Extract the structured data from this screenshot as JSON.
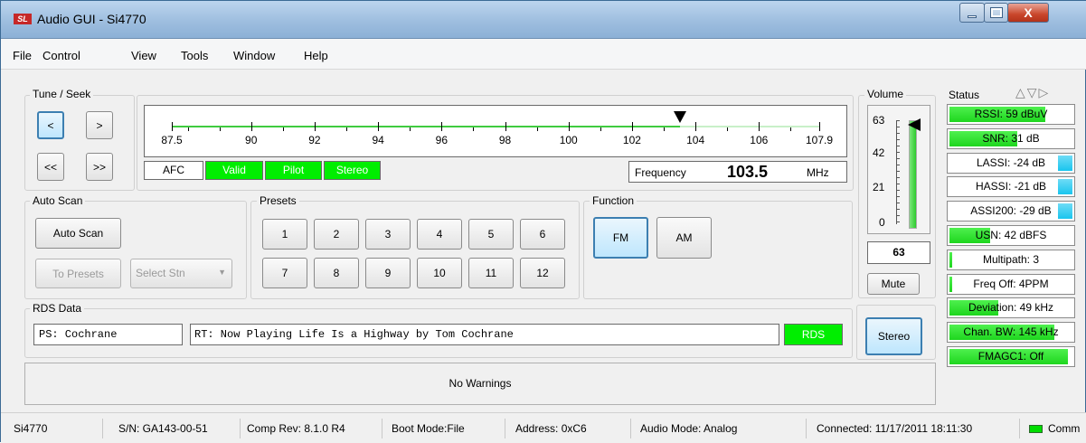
{
  "window": {
    "title": "Audio GUI - Si4770",
    "close_glyph": "X"
  },
  "menu": [
    "File",
    "Control",
    "View",
    "Tools",
    "Window",
    "Help"
  ],
  "tune_seek": {
    "label": "Tune / Seek",
    "buttons": [
      "<",
      ">",
      "<<",
      ">>"
    ],
    "scale_ticks": [
      "87.5",
      "90",
      "92",
      "94",
      "96",
      "98",
      "100",
      "102",
      "104",
      "106",
      "107.9"
    ],
    "current_frequency": 103.5,
    "indicators": [
      {
        "label": "AFC",
        "active": false
      },
      {
        "label": "Valid",
        "active": true
      },
      {
        "label": "Pilot",
        "active": true
      },
      {
        "label": "Stereo",
        "active": true
      }
    ],
    "frequency_label": "Frequency",
    "frequency_value": "103.5",
    "frequency_unit": "MHz"
  },
  "volume": {
    "label": "Volume",
    "ticks": [
      "63",
      "42",
      "21",
      "0"
    ],
    "value": "63",
    "level": 1.0,
    "mute_label": "Mute"
  },
  "status": {
    "label": "Status",
    "arrows": "△▽▷",
    "items": [
      {
        "text": "RSSI: 59 dBuV",
        "fill": 0.78
      },
      {
        "text": "SNR: 31 dB",
        "fill": 0.55
      },
      {
        "text": "LASSI: -24 dB",
        "fill": 0.12,
        "right": true
      },
      {
        "text": "HASSI: -21 dB",
        "fill": 0.12,
        "right": true
      },
      {
        "text": "ASSI200: -29 dB",
        "fill": 0.12,
        "right": true
      },
      {
        "text": "USN: 42 dBFS",
        "fill": 0.33
      },
      {
        "text": "Multipath: 3",
        "fill": 0.02
      },
      {
        "text": "Freq Off: 4PPM",
        "fill": 0.02
      },
      {
        "text": "Deviation: 49 kHz",
        "fill": 0.4
      },
      {
        "text": "Chan. BW: 145 kHz",
        "fill": 0.85
      },
      {
        "text": "FMAGC1: Off",
        "fill": 0.96
      }
    ]
  },
  "auto_scan": {
    "label": "Auto Scan",
    "auto_scan_button": "Auto Scan",
    "to_presets_button": "To Presets",
    "select_station": "Select Stn"
  },
  "presets": {
    "label": "Presets",
    "buttons": [
      "1",
      "2",
      "3",
      "4",
      "5",
      "6",
      "7",
      "8",
      "9",
      "10",
      "11",
      "12"
    ]
  },
  "function": {
    "label": "Function",
    "fm": "FM",
    "am": "AM"
  },
  "rds": {
    "label": "RDS Data",
    "ps": "PS: Cochrane",
    "rt": "RT: Now Playing Life Is a Highway by Tom Cochrane",
    "badge": "RDS"
  },
  "stereo_button": "Stereo",
  "warnings": "No Warnings",
  "statusbar": {
    "device": "Si4770",
    "serial": "S/N: GA143-00-51",
    "comp_rev": "Comp Rev: 8.1.0 R4",
    "boot_mode": "Boot Mode:File",
    "address": "Address: 0xC6",
    "audio_mode": "Audio Mode: Analog",
    "connected": "Connected: 11/17/2011 18:11:30",
    "comm": "Comm"
  },
  "colors": {
    "accent_green": "#00ee00",
    "status_cyan": "#19c5ee",
    "title_blue": "#9ebedf"
  }
}
